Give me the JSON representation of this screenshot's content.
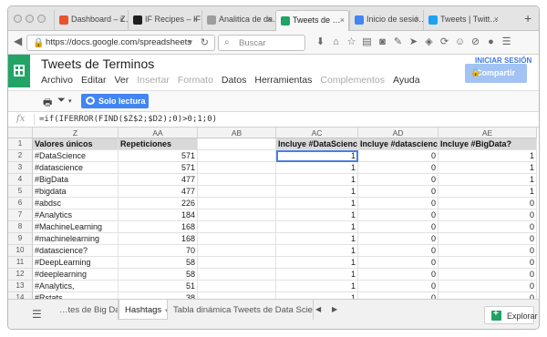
{
  "browser": {
    "tabs": [
      {
        "label": "Dashboard – Z…",
        "color": "#e8542e"
      },
      {
        "label": "IF Recipes – IF…",
        "color": "#1f1f1f"
      },
      {
        "label": "Analitica de da…",
        "color": "#9e9e9e"
      },
      {
        "label": "Tweets de …",
        "color": "#1fa463"
      },
      {
        "label": "Inicio de sesió…",
        "color": "#4285f4"
      },
      {
        "label": "Tweets | Twitt…",
        "color": "#1da1f2"
      }
    ],
    "url": "https://docs.google.com/spreadsheets",
    "search_placeholder": "Buscar"
  },
  "doc": {
    "title": "Tweets de Terminos",
    "menu": [
      "Archivo",
      "Editar",
      "Ver",
      "Insertar",
      "Formato",
      "Datos",
      "Herramientas",
      "Complementos",
      "Ayuda"
    ],
    "menu_disabled": [
      false,
      false,
      false,
      true,
      true,
      false,
      false,
      true,
      false
    ],
    "signin": "INICIAR SESIÓN",
    "share": "Compartir",
    "readonly": "Solo lectura",
    "formula": "=if(IFERROR(FIND($Z$2;$D2);0)>0;1;0)"
  },
  "grid": {
    "columns": [
      "Z",
      "AA",
      "AB",
      "AC",
      "AD",
      "AE"
    ],
    "header_row": [
      "Valores únicos",
      "Repeticiones",
      "",
      "Incluye #DataScience?",
      "Incluye #datascience?",
      "Incluye #BigData?"
    ],
    "rows": [
      {
        "n": "2",
        "z": "#DataScience",
        "aa": "571",
        "ac": "1",
        "ad": "0",
        "ae": "1"
      },
      {
        "n": "3",
        "z": "#datascience",
        "aa": "571",
        "ac": "1",
        "ad": "0",
        "ae": "1"
      },
      {
        "n": "4",
        "z": "#BigData",
        "aa": "477",
        "ac": "1",
        "ad": "0",
        "ae": "1"
      },
      {
        "n": "5",
        "z": "#bigdata",
        "aa": "477",
        "ac": "1",
        "ad": "0",
        "ae": "1"
      },
      {
        "n": "6",
        "z": "#abdsc",
        "aa": "226",
        "ac": "1",
        "ad": "0",
        "ae": "0"
      },
      {
        "n": "7",
        "z": "#Analytics",
        "aa": "184",
        "ac": "1",
        "ad": "0",
        "ae": "0"
      },
      {
        "n": "8",
        "z": "#MachineLearning",
        "aa": "168",
        "ac": "1",
        "ad": "0",
        "ae": "0"
      },
      {
        "n": "9",
        "z": "#machinelearning",
        "aa": "168",
        "ac": "1",
        "ad": "0",
        "ae": "0"
      },
      {
        "n": "10",
        "z": "#datascience?",
        "aa": "70",
        "ac": "1",
        "ad": "0",
        "ae": "0"
      },
      {
        "n": "11",
        "z": "#DeepLearning",
        "aa": "58",
        "ac": "1",
        "ad": "0",
        "ae": "0"
      },
      {
        "n": "12",
        "z": "#deeplearning",
        "aa": "58",
        "ac": "1",
        "ad": "0",
        "ae": "0"
      },
      {
        "n": "13",
        "z": "#Analytics,",
        "aa": "51",
        "ac": "1",
        "ad": "0",
        "ae": "0"
      },
      {
        "n": "14",
        "z": "#Rstats",
        "aa": "38",
        "ac": "1",
        "ad": "0",
        "ae": "0"
      }
    ]
  },
  "sheets": [
    "…tes de Big Data",
    "Hashtags",
    "Tabla dinámica Tweets de Data Science"
  ],
  "explore": "Explorar"
}
